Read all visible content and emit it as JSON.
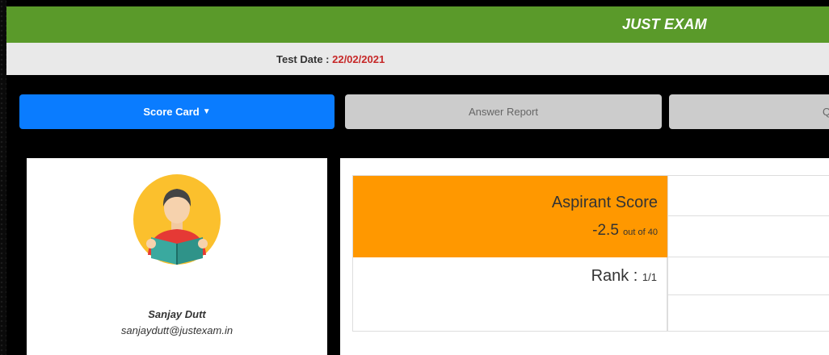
{
  "header": {
    "title": "JUST EXAM"
  },
  "test_info": {
    "label": "Test Date : ",
    "date": "22/02/2021"
  },
  "tabs": [
    {
      "label": "Score Card",
      "active": true
    },
    {
      "label": "Answer Report",
      "active": false
    },
    {
      "label": "Question",
      "active": false
    }
  ],
  "profile": {
    "avatar": "reader-avatar-icon",
    "name": "Sanjay Dutt",
    "email": "sanjaydutt@justexam.in"
  },
  "score": {
    "label": "Aspirant Score",
    "value": "-2.5",
    "out_of": "out of 40",
    "rank_label": "Rank : ",
    "rank_value": "1/1"
  },
  "colors": {
    "header": "#5a9a2a",
    "active_tab": "#0a7cff",
    "score_bg": "#ff9800",
    "date": "#c62828"
  }
}
